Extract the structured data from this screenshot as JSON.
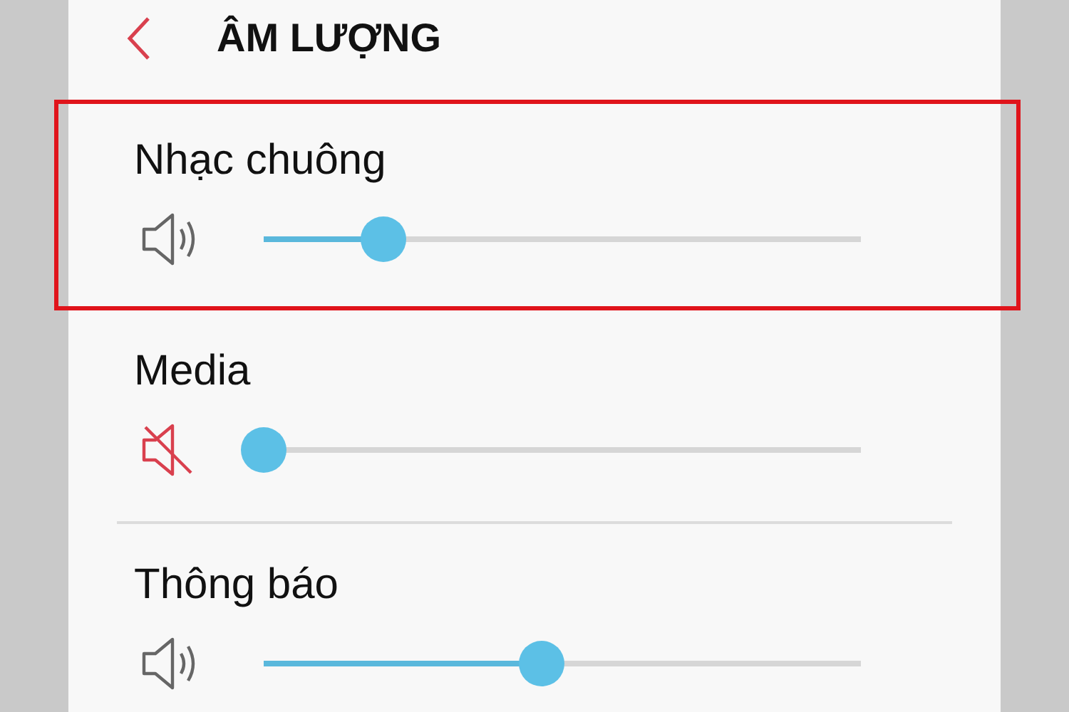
{
  "header": {
    "title": "ÂM LƯỢNG"
  },
  "channels": [
    {
      "name": "Nhạc chuông",
      "muted": false,
      "level": 0.2,
      "highlighted": true,
      "divider": false
    },
    {
      "name": "Media",
      "muted": true,
      "level": 0,
      "highlighted": false,
      "divider": false
    },
    {
      "name": "Thông báo",
      "muted": false,
      "level": 0.465,
      "highlighted": false,
      "divider": true
    }
  ]
}
